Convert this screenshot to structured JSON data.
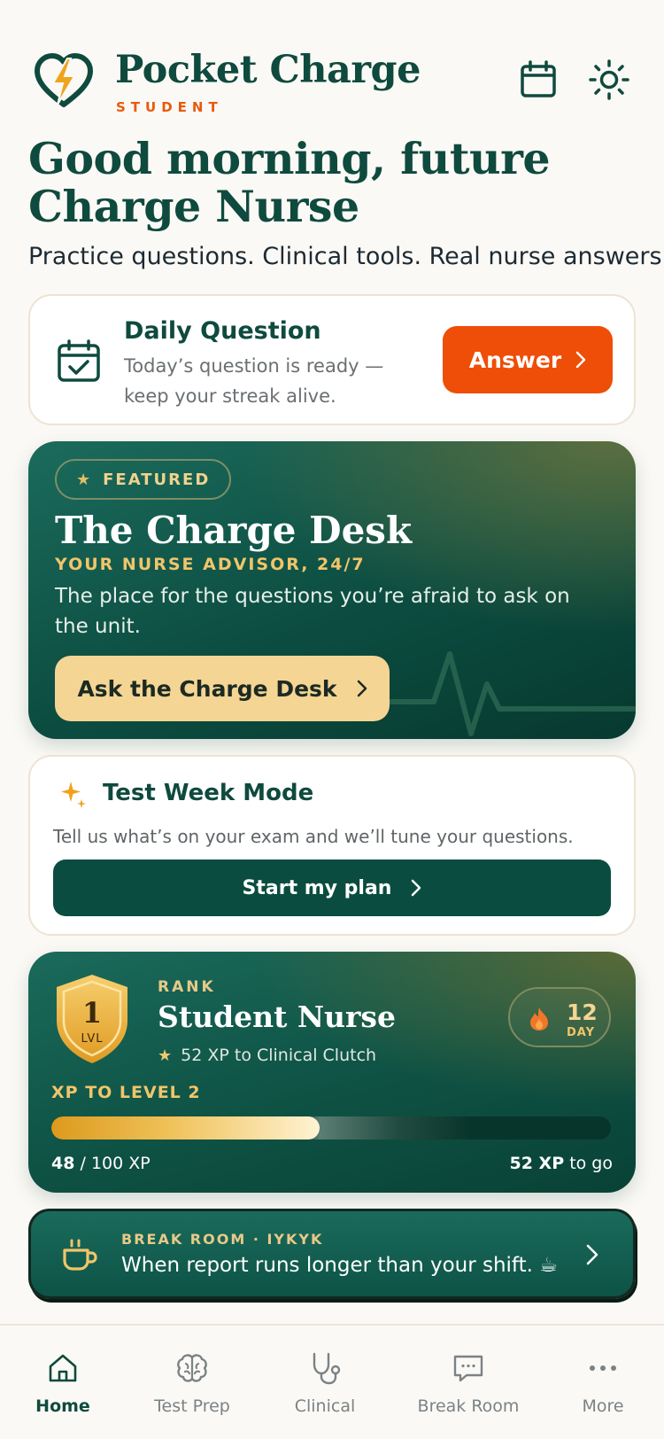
{
  "header": {
    "brand_name": "Pocket Charge",
    "brand_sub": "STUDENT",
    "calendar_icon": "calendar-icon",
    "theme_icon": "sun-icon"
  },
  "greeting": {
    "title": "Good morning, future Charge Nurse",
    "tagline": "Practice questions. Clinical tools. Real nurse answers."
  },
  "daily_question": {
    "title": "Daily Question",
    "description": "Today’s question is ready — keep your streak alive.",
    "button_label": "Answer"
  },
  "featured": {
    "badge": "FEATURED",
    "title": "The Charge Desk",
    "subtitle": "YOUR NURSE ADVISOR, 24/7",
    "description": "The place for the questions you’re afraid to ask on the unit.",
    "button_label": "Ask the Charge Desk"
  },
  "test_week": {
    "title": "Test Week Mode",
    "description": "Tell us what’s on your exam and we’ll tune your questions.",
    "button_label": "Start my plan"
  },
  "rank": {
    "level": "1",
    "level_unit": "LVL",
    "label": "RANK",
    "name": "Student Nurse",
    "next": "52 XP to Clinical Clutch",
    "streak_count": "12",
    "streak_unit": "DAY",
    "xp_label": "XP TO LEVEL 2",
    "xp_current": "48",
    "xp_total": "/ 100 XP",
    "xp_remaining": "52 XP",
    "xp_remaining_suffix": "to go",
    "xp_progress": 0.48
  },
  "break_room": {
    "label": "BREAK ROOM · IYKYK",
    "text": "When report runs longer than your shift. ☕"
  },
  "tabs": [
    {
      "label": "Home",
      "icon": "home-icon",
      "active": true
    },
    {
      "label": "Test Prep",
      "icon": "brain-icon",
      "active": false
    },
    {
      "label": "Clinical",
      "icon": "stethoscope-icon",
      "active": false
    },
    {
      "label": "Break Room",
      "icon": "chat-bubble-icon",
      "active": false
    },
    {
      "label": "More",
      "icon": "more-dots-icon",
      "active": false
    }
  ],
  "colors": {
    "brand_green": "#0f4a3e",
    "accent_orange": "#ee4e07",
    "gold": "#f1c56a",
    "background": "#fbf9f5"
  }
}
